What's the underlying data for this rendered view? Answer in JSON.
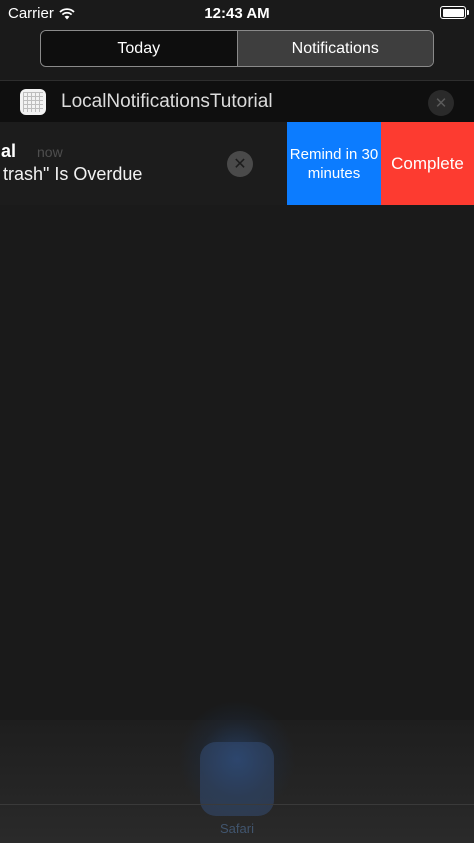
{
  "status_bar": {
    "carrier": "Carrier",
    "time": "12:43 AM",
    "battery_level": 1.0
  },
  "segmented_control": {
    "today_label": "Today",
    "notifications_label": "Notifications",
    "selected": "Today"
  },
  "app_group": {
    "name": "LocalNotificationsTutorial",
    "clear_symbol": "✕"
  },
  "notification": {
    "title": "al",
    "time": "now",
    "body": "trash\" Is Overdue",
    "dismiss_symbol": "✕",
    "actions": [
      {
        "label": "Remind in 30 minutes",
        "color": "#0c7cff"
      },
      {
        "label": "Complete",
        "color": "#fd3b30"
      }
    ]
  },
  "dock": {
    "app_label": "Safari"
  },
  "icons": {
    "wifi": "wifi-icon",
    "battery": "battery-icon",
    "app": "app-grid-icon",
    "clear": "close-icon",
    "dismiss": "close-icon"
  }
}
